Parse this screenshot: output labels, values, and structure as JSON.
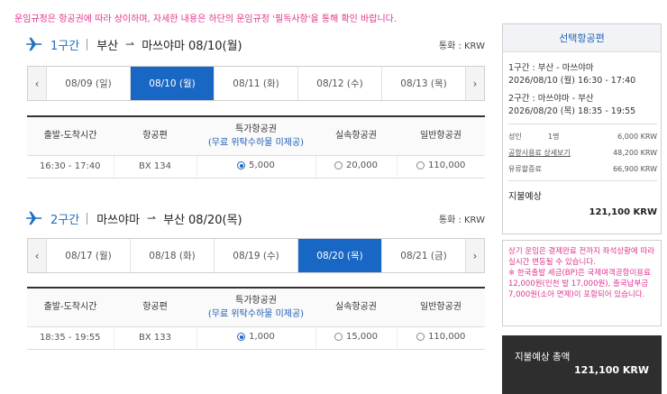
{
  "notice": "운임규정은 항공권에 따라 상이하며, 자세한 내용은 하단의 운임규정 '필독사항'을 통해 확인 바랍니다.",
  "segments": [
    {
      "label": "1구간",
      "from": "부산",
      "to": "마쓰야마",
      "date": "08/10(월)",
      "currency": "통화 : KRW",
      "dates": [
        "08/09 (일)",
        "08/10 (월)",
        "08/11 (화)",
        "08/12 (수)",
        "08/13 (목)"
      ],
      "active_index": 1,
      "headers": {
        "time": "출발-도착시간",
        "flight": "항공편",
        "special": "특가항공권",
        "special_sub": "(무료 위탁수하물 미제공)",
        "discount": "실속항공권",
        "normal": "일반항공권"
      },
      "row": {
        "time": "16:30 - 17:40",
        "flight": "BX 134",
        "special": "5,000",
        "discount": "20,000",
        "normal": "110,000",
        "selected": "special"
      }
    },
    {
      "label": "2구간",
      "from": "마쓰야마",
      "to": "부산",
      "date": "08/20(목)",
      "currency": "통화 : KRW",
      "dates": [
        "08/17 (월)",
        "08/18 (화)",
        "08/19 (수)",
        "08/20 (목)",
        "08/21 (금)"
      ],
      "active_index": 3,
      "headers": {
        "time": "출발-도착시간",
        "flight": "항공편",
        "special": "특가항공권",
        "special_sub": "(무료 위탁수하물 미제공)",
        "discount": "실속항공권",
        "normal": "일반항공권"
      },
      "row": {
        "time": "18:35 - 19:55",
        "flight": "BX 133",
        "special": "1,000",
        "discount": "15,000",
        "normal": "110,000",
        "selected": "special"
      }
    }
  ],
  "summary": {
    "title": "선택항공편",
    "seg1_title": "1구간 : 부산 - 마쓰야마",
    "seg1_time": "2026/08/10 (월) 16:30 - 17:40",
    "seg2_title": "2구간 : 마쓰야마 - 부산",
    "seg2_time": "2026/08/20 (목) 18:35 - 19:55",
    "adult_label": "성인",
    "adult_count": "1명",
    "adult_amount": "6,000 KRW",
    "tax_label": "공항사용료 상세보기",
    "tax_amount": "48,200 KRW",
    "fuel_label": "유류할증료",
    "fuel_amount": "66,900 KRW",
    "pay_label": "지불예상",
    "pay_amount": "121,100 KRW"
  },
  "warning": {
    "line1": "상기 운임은 결제완료 전까지 좌석상황에 따라 실시간 변동될 수 있습니다.",
    "line2": "※ 한국출발 세금(BP)은 국제여객공항이용료 12,000원(인천 발 17,000원), 출국납부금 7,000원(소아 면제)이 포함되어 있습니다."
  },
  "total": {
    "label": "지불예상 총액",
    "amount": "121,100 KRW"
  },
  "colors": {
    "accent": "#1967c4",
    "notice": "#e0348f",
    "total_bg": "#2e2e2e"
  }
}
